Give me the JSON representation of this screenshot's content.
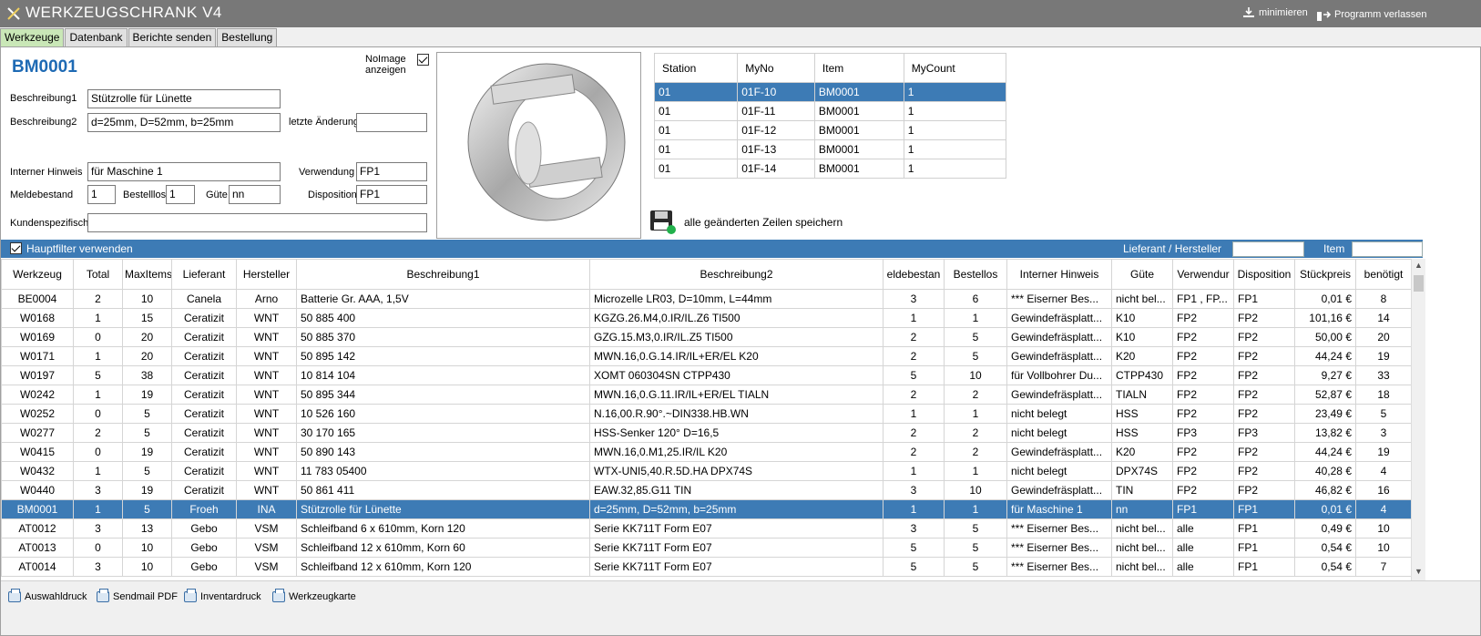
{
  "window": {
    "title": "WERKZEUGSCHRANK V4",
    "minimize_label": "minimieren",
    "exit_label": "Programm verlassen"
  },
  "tabs": [
    {
      "label": "Werkzeuge",
      "active": true
    },
    {
      "label": "Datenbank",
      "active": false
    },
    {
      "label": "Berichte senden",
      "active": false
    },
    {
      "label": "Bestellung",
      "active": false
    }
  ],
  "detail": {
    "item_id": "BM0001",
    "noimage_label_1": "NoImage",
    "noimage_label_2": "anzeigen",
    "noimage_checked": true,
    "beschreibung1_label": "Beschreibung1",
    "beschreibung1": "Stützrolle für Lünette",
    "beschreibung2_label": "Beschreibung2",
    "beschreibung2": "d=25mm, D=52mm, b=25mm",
    "letzte_aenderung_label": "letzte Änderung",
    "letzte_aenderung": "",
    "interner_hinweis_label": "Interner Hinweis",
    "interner_hinweis": "für Maschine 1",
    "verwendung_label": "Verwendung",
    "verwendung": "FP1",
    "meldebestand_label": "Meldebestand",
    "meldebestand": "1",
    "bestelllos_label": "Bestelllos",
    "bestelllos": "1",
    "guete_label": "Güte",
    "guete": "nn",
    "disposition_label": "Disposition",
    "disposition": "FP1",
    "kundenspezifisch_label": "Kundenspezifisch",
    "kundenspezifisch": ""
  },
  "stations": {
    "headers": [
      "Station",
      "MyNo",
      "Item",
      "MyCount"
    ],
    "rows": [
      [
        "01",
        "01F-10",
        "BM0001",
        "1"
      ],
      [
        "01",
        "01F-11",
        "BM0001",
        "1"
      ],
      [
        "01",
        "01F-12",
        "BM0001",
        "1"
      ],
      [
        "01",
        "01F-13",
        "BM0001",
        "1"
      ],
      [
        "01",
        "01F-14",
        "BM0001",
        "1"
      ]
    ],
    "selected_row": 0
  },
  "save_label": "alle geänderten Zeilen speichern",
  "filter": {
    "hauptfilter_label": "Hauptfilter verwenden",
    "hauptfilter_checked": true,
    "lieferant_label": "Lieferant / Hersteller",
    "lieferant_value": "",
    "item_label": "Item",
    "item_value": ""
  },
  "grid": {
    "headers": [
      "Werkzeug",
      "Total",
      "MaxItems",
      "Lieferant",
      "Hersteller",
      "Beschreibung1",
      "Beschreibung2",
      "eldebestan",
      "Bestellos",
      "Interner Hinweis",
      "Güte",
      "Verwendur",
      "Disposition",
      "Stückpreis",
      "benötigt"
    ],
    "rows": [
      [
        "BE0004",
        "2",
        "10",
        "Canela",
        "Arno",
        "Batterie Gr. AAA, 1,5V",
        "Microzelle LR03, D=10mm, L=44mm",
        "3",
        "6",
        "*** Eiserner Bes...",
        "nicht bel...",
        "FP1 , FP...",
        "FP1",
        "0,01 €",
        "8"
      ],
      [
        "W0168",
        "1",
        "15",
        "Ceratizit",
        "WNT",
        "50 885 400",
        "KGZG.26.M4,0.IR/IL.Z6 TI500",
        "1",
        "1",
        "Gewindefräsplatt...",
        "K10",
        "FP2",
        "FP2",
        "101,16 €",
        "14"
      ],
      [
        "W0169",
        "0",
        "20",
        "Ceratizit",
        "WNT",
        "50 885 370",
        "GZG.15.M3,0.IR/IL.Z5 TI500",
        "2",
        "5",
        "Gewindefräsplatt...",
        "K10",
        "FP2",
        "FP2",
        "50,00 €",
        "20"
      ],
      [
        "W0171",
        "1",
        "20",
        "Ceratizit",
        "WNT",
        "50 895 142",
        "MWN.16,0.G.14.IR/IL+ER/EL K20",
        "2",
        "5",
        "Gewindefräsplatt...",
        "K20",
        "FP2",
        "FP2",
        "44,24 €",
        "19"
      ],
      [
        "W0197",
        "5",
        "38",
        "Ceratizit",
        "WNT",
        "10 814 104",
        "XOMT 060304SN CTPP430",
        "5",
        "10",
        "für Vollbohrer Du...",
        "CTPP430",
        "FP2",
        "FP2",
        "9,27 €",
        "33"
      ],
      [
        "W0242",
        "1",
        "19",
        "Ceratizit",
        "WNT",
        "50 895 344",
        "MWN.16,0.G.11.IR/IL+ER/EL TIALN",
        "2",
        "2",
        "Gewindefräsplatt...",
        "TIALN",
        "FP2",
        "FP2",
        "52,87 €",
        "18"
      ],
      [
        "W0252",
        "0",
        "5",
        "Ceratizit",
        "WNT",
        "10 526 160",
        "N.16,00.R.90°.~DIN338.HB.WN",
        "1",
        "1",
        "nicht belegt",
        "HSS",
        "FP2",
        "FP2",
        "23,49 €",
        "5"
      ],
      [
        "W0277",
        "2",
        "5",
        "Ceratizit",
        "WNT",
        "30 170 165",
        "HSS-Senker 120° D=16,5",
        "2",
        "2",
        "nicht belegt",
        "HSS",
        "FP3",
        "FP3",
        "13,82 €",
        "3"
      ],
      [
        "W0415",
        "0",
        "19",
        "Ceratizit",
        "WNT",
        "50 890 143",
        "MWN.16,0.M1,25.IR/IL K20",
        "2",
        "2",
        "Gewindefräsplatt...",
        "K20",
        "FP2",
        "FP2",
        "44,24 €",
        "19"
      ],
      [
        "W0432",
        "1",
        "5",
        "Ceratizit",
        "WNT",
        "11 783 05400",
        "WTX-UNI5,40.R.5D.HA DPX74S",
        "1",
        "1",
        "nicht belegt",
        "DPX74S",
        "FP2",
        "FP2",
        "40,28 €",
        "4"
      ],
      [
        "W0440",
        "3",
        "19",
        "Ceratizit",
        "WNT",
        "50 861 411",
        "EAW.32,85.G11 TIN",
        "3",
        "10",
        "Gewindefräsplatt...",
        "TIN",
        "FP2",
        "FP2",
        "46,82 €",
        "16"
      ],
      [
        "BM0001",
        "1",
        "5",
        "Froeh",
        "INA",
        "Stützrolle für Lünette",
        "d=25mm, D=52mm, b=25mm",
        "1",
        "1",
        "für Maschine 1",
        "nn",
        "FP1",
        "FP1",
        "0,01 €",
        "4"
      ],
      [
        "AT0012",
        "3",
        "13",
        "Gebo",
        "VSM",
        "Schleifband 6 x 610mm, Korn 120",
        "Serie KK711T Form E07",
        "3",
        "5",
        "*** Eiserner Bes...",
        "nicht bel...",
        "alle",
        "FP1",
        "0,49 €",
        "10"
      ],
      [
        "AT0013",
        "0",
        "10",
        "Gebo",
        "VSM",
        "Schleifband 12 x 610mm, Korn 60",
        "Serie KK711T Form E07",
        "5",
        "5",
        "*** Eiserner Bes...",
        "nicht bel...",
        "alle",
        "FP1",
        "0,54 €",
        "10"
      ],
      [
        "AT0014",
        "3",
        "10",
        "Gebo",
        "VSM",
        "Schleifband 12 x 610mm, Korn 120",
        "Serie KK711T Form E07",
        "5",
        "5",
        "*** Eiserner Bes...",
        "nicht bel...",
        "alle",
        "FP1",
        "0,54 €",
        "7"
      ]
    ],
    "selected_row": 11
  },
  "bottom_buttons": [
    "Auswahldruck",
    "Sendmail PDF",
    "Inventardruck",
    "Werkzeugkarte"
  ],
  "colors": {
    "titlebar": "#787878",
    "selection": "#3d7bb5",
    "active_tab": "#c9e7b7",
    "item_id": "#1e6ab4"
  },
  "icons": {
    "app": "tools-icon",
    "minimize": "download-icon",
    "exit": "exit-icon",
    "save": "floppy-disk-icon",
    "print": "printer-icon"
  }
}
